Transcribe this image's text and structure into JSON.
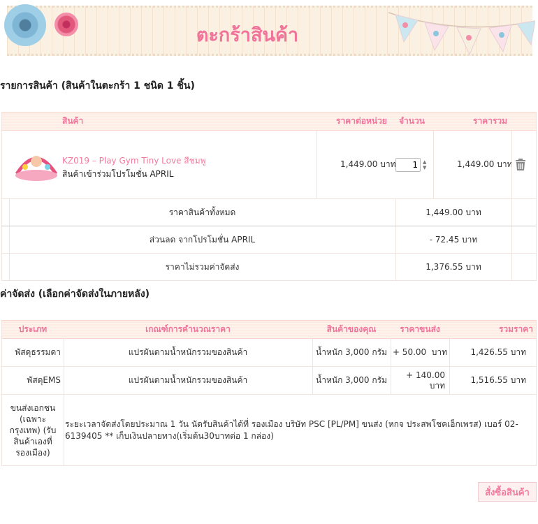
{
  "banner": {
    "title": "ตะกร้าสินค้า"
  },
  "cart": {
    "heading": "รายการสินค้า (สินค้าในตะกร้า 1 ชนิด 1 ชิ้น)",
    "headers": {
      "product": "สินค้า",
      "unit_price": "ราคาต่อหน่วย",
      "quantity": "จำนวน",
      "total": "ราคารวม"
    },
    "items": [
      {
        "name": "KZ019 – Play Gym Tiny Love สีชมพู",
        "note": "สินค้าเข้าร่วมโปรโมชั่น APRIL",
        "unit_price": "1,449.00 บาท",
        "quantity": "1",
        "total": "1,449.00 บาท"
      }
    ],
    "summary": [
      {
        "label": "ราคาสินค้าทั้งหมด",
        "value": "1,449.00 บาท"
      },
      {
        "label": "ส่วนลด จากโปรโมชั่น APRIL",
        "value": "- 72.45 บาท"
      },
      {
        "label": "ราคาไม่รวมค่าจัดส่ง",
        "value": "1,376.55 บาท"
      }
    ]
  },
  "shipping": {
    "heading": "ค่าจัดส่ง (เลือกค่าจัดส่งในภายหลัง)",
    "headers": {
      "type": "ประเภท",
      "criteria": "เกณฑ์การคำนวณราคา",
      "your_items": "สินค้าของคุณ",
      "fee": "ราคาขนส่ง",
      "total": "รวมราคา"
    },
    "rows": [
      {
        "type": "พัสดุธรรมดา",
        "criteria": "แปรผันตามน้ำหนักรวมของสินค้า",
        "weight": "น้ำหนัก 3,000 กรัม",
        "fee": "+ 50.00  บาท",
        "total": "1,426.55 บาท"
      },
      {
        "type": "พัสดุEMS",
        "criteria": "แปรผันตามน้ำหนักรวมของสินค้า",
        "weight": "น้ำหนัก 3,000 กรัม",
        "fee": "+ 140.00 บาท",
        "total": "1,516.55 บาท"
      }
    ],
    "private": {
      "type": "ขนส่งเอกชน (เฉพาะกรุงเทพ) (รับสินค้าเองที่รองเมือง)",
      "description": "ระยะเวลาจัดส่งโดยประมาณ 1 วัน นัดรับสินค้าได้ที่ รองเมือง บริษัท PSC [PL/PM] ขนส่ง (หกจ ประสพโชคเอ็กเพรส) เบอร์ 02-6139405 ** เก็บเงินปลายทาง(เริ่มต้น30บาทต่อ 1 กล่อง)"
    }
  },
  "actions": {
    "order_label": "สั่งซื้อสินค้า"
  }
}
